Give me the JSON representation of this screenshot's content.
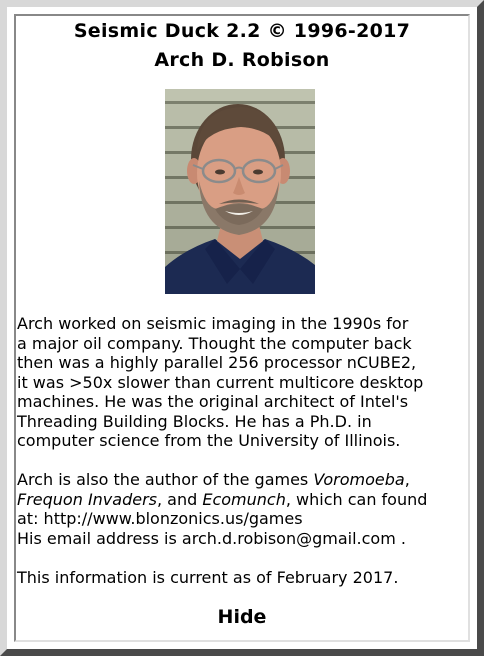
{
  "header": {
    "title_line1": "Seismic Duck 2.2 © 1996-2017",
    "title_line2": "Arch D. Robison"
  },
  "photo": {
    "subject": "portrait of Arch D. Robison"
  },
  "bio": {
    "para1": [
      "Arch worked on seismic imaging in the 1990s for",
      "a major oil company.  Thought the computer back",
      "then was a highly parallel 256 processor nCUBE2,",
      "it was >50x slower than current multicore desktop",
      "machines.  He was the original architect of Intel's",
      "Threading Building Blocks.  He has a Ph.D. in",
      "computer science from the University of Illinois."
    ],
    "para2": {
      "line1_pre": "Arch is also the author of the games ",
      "game1": "Voromoeba",
      "line1_post": ",",
      "game2": "Frequon Invaders",
      "line2_mid": ", and ",
      "game3": "Ecomunch",
      "line2_post": ", which can found",
      "line3": "at: http://www.blonzonics.us/games",
      "line4": "His email address is arch.d.robison@gmail.com ."
    },
    "para3": "This information is current as of February 2017."
  },
  "footer": {
    "hide_label": "Hide"
  },
  "colors": {
    "background": "#ffffff",
    "bevel_light": "#d8d8d8",
    "bevel_dark": "#4a4a4a",
    "text": "#000000"
  }
}
